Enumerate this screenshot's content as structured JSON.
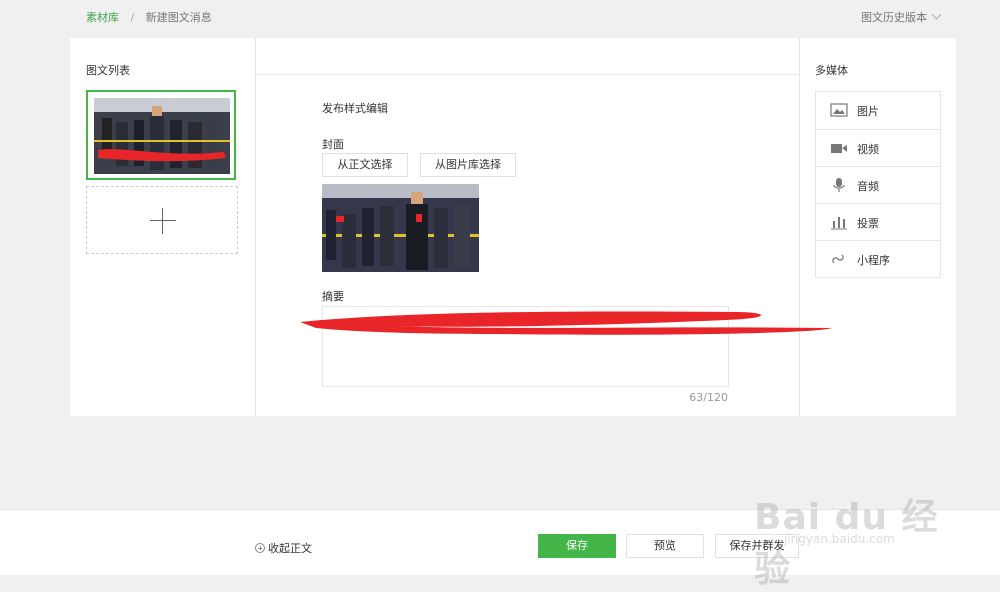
{
  "breadcrumb": {
    "root": "素材库",
    "current": "新建图文消息"
  },
  "history": {
    "label": "图文历史版本"
  },
  "article_list": {
    "title": "图文列表"
  },
  "editor": {
    "style_label": "发布样式编辑",
    "cover_label": "封面",
    "from_body_button": "从正文选择",
    "from_library_button": "从图片库选择",
    "summary_label": "摘要",
    "summary_counter": "63/120"
  },
  "media": {
    "title": "多媒体",
    "items": [
      {
        "label": "图片",
        "icon": "image-icon"
      },
      {
        "label": "视频",
        "icon": "video-icon"
      },
      {
        "label": "音频",
        "icon": "microphone-icon"
      },
      {
        "label": "投票",
        "icon": "bar-chart-icon"
      },
      {
        "label": "小程序",
        "icon": "link-icon"
      }
    ]
  },
  "footer": {
    "collapse_label": "收起正文",
    "save_button": "保存",
    "preview_button": "预览",
    "save_publish_button": "保存并群发"
  },
  "watermark": {
    "text": "Bai du 经验",
    "url": "jingyan.baidu.com"
  },
  "colors": {
    "accent": "#44b549",
    "scribble": "#e8262a"
  }
}
